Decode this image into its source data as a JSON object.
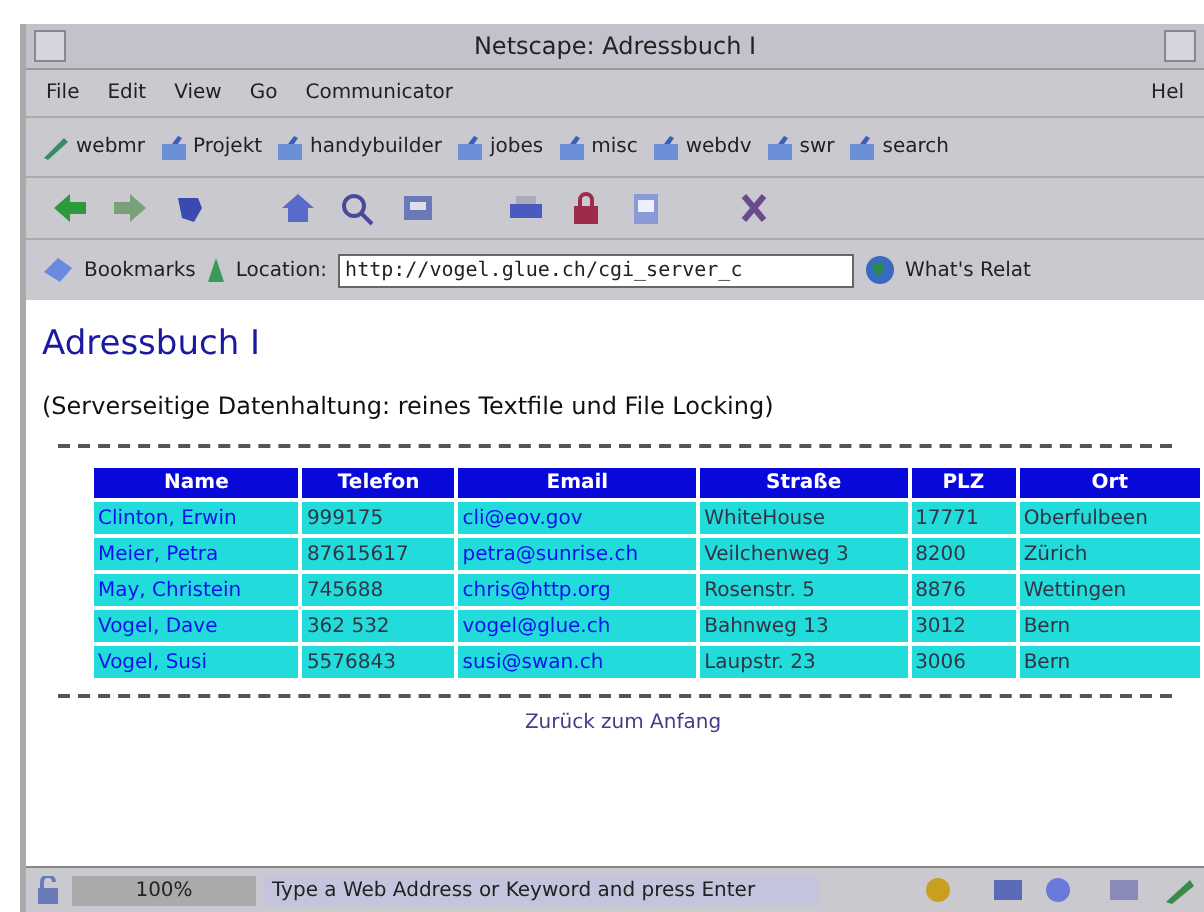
{
  "window": {
    "title": "Netscape: Adressbuch I"
  },
  "menu": [
    "File",
    "Edit",
    "View",
    "Go",
    "Communicator"
  ],
  "menu_right": "Hel",
  "bookmarks": [
    {
      "kind": "pen",
      "label": "webmr"
    },
    {
      "kind": "folder",
      "label": "Projekt"
    },
    {
      "kind": "folder",
      "label": "handybuilder"
    },
    {
      "kind": "folder",
      "label": "jobes"
    },
    {
      "kind": "folder",
      "label": "misc"
    },
    {
      "kind": "folder",
      "label": "webdv"
    },
    {
      "kind": "folder",
      "label": "swr"
    },
    {
      "kind": "folder",
      "label": "search"
    }
  ],
  "location_bar": {
    "bookmarks_label": "Bookmarks",
    "location_label": "Location:",
    "url": "http://vogel.glue.ch/cgi_server_c",
    "related_label": "What's Relat"
  },
  "page": {
    "heading": "Adressbuch I",
    "subtitle": "(Serverseitige Datenhaltung: reines Textfile und File Locking)",
    "table": {
      "columns": [
        "Name",
        "Telefon",
        "Email",
        "Straße",
        "PLZ",
        "Ort"
      ],
      "rows": [
        [
          "Clinton, Erwin",
          "999175",
          "cli@eov.gov",
          "WhiteHouse",
          "17771",
          "Oberfulbeen"
        ],
        [
          "Meier, Petra",
          "87615617",
          "petra@sunrise.ch",
          "Veilchenweg 3",
          "8200",
          "Zürich"
        ],
        [
          "May, Christein",
          "745688",
          "chris@http.org",
          "Rosenstr. 5",
          "8876",
          "Wettingen"
        ],
        [
          "Vogel, Dave",
          "362 532",
          "vogel@glue.ch",
          "Bahnweg 13",
          "3012",
          "Bern"
        ],
        [
          "Vogel, Susi",
          "5576843",
          "susi@swan.ch",
          "Laupstr. 23",
          "3006",
          "Bern"
        ]
      ]
    },
    "back_link": "Zurück zum Anfang"
  },
  "status_bar": {
    "progress": "100%",
    "message": "Type a Web Address or Keyword and press Enter"
  }
}
